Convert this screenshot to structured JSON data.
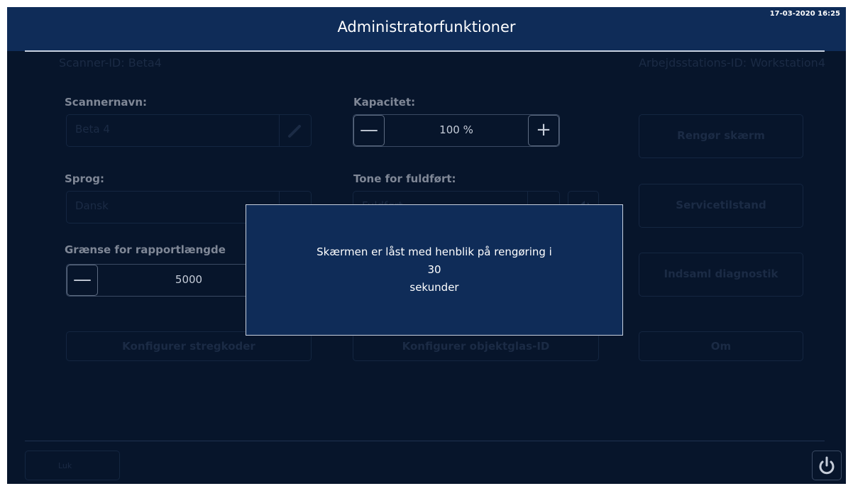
{
  "header": {
    "title": "Administratorfunktioner",
    "datetime": "17-03-2020 16:25"
  },
  "ids": {
    "scanner_id": "Scanner-ID: Beta4",
    "workstation_id": "Arbejdsstations-ID: Workstation4"
  },
  "scanner_name": {
    "label": "Scannernavn:",
    "value": "Beta 4"
  },
  "capacity": {
    "label": "Kapacitet:",
    "value": "100 %"
  },
  "language": {
    "label": "Sprog:",
    "value": "Dansk"
  },
  "completion_tone": {
    "label": "Tone for fuldført:",
    "value": "Fuldført"
  },
  "report_limit": {
    "label": "Grænse for rapportlængde",
    "value": "5000"
  },
  "buttons": {
    "clean_screen": "Rengør skærm",
    "service_mode": "Servicetilstand",
    "collect_diagnostics": "Indsaml diagnostik",
    "about": "Om",
    "configure_barcodes": "Konfigurer stregkoder",
    "configure_slide_id": "Konfigurer objektglas-ID",
    "close": "Luk"
  },
  "modal": {
    "line1": "Skærmen er låst med henblik på rengøring i",
    "countdown": "30",
    "line3": "sekunder"
  },
  "colors": {
    "background": "#07152b",
    "header": "#0f2c58",
    "modal": "#0f2c58",
    "border_light": "#c7d1e0"
  },
  "icons": {
    "edit": "pencil-icon",
    "dropdown": "chevron-down-icon",
    "sound": "speaker-icon",
    "minus": "minus-icon",
    "plus": "plus-icon",
    "power": "power-icon"
  }
}
